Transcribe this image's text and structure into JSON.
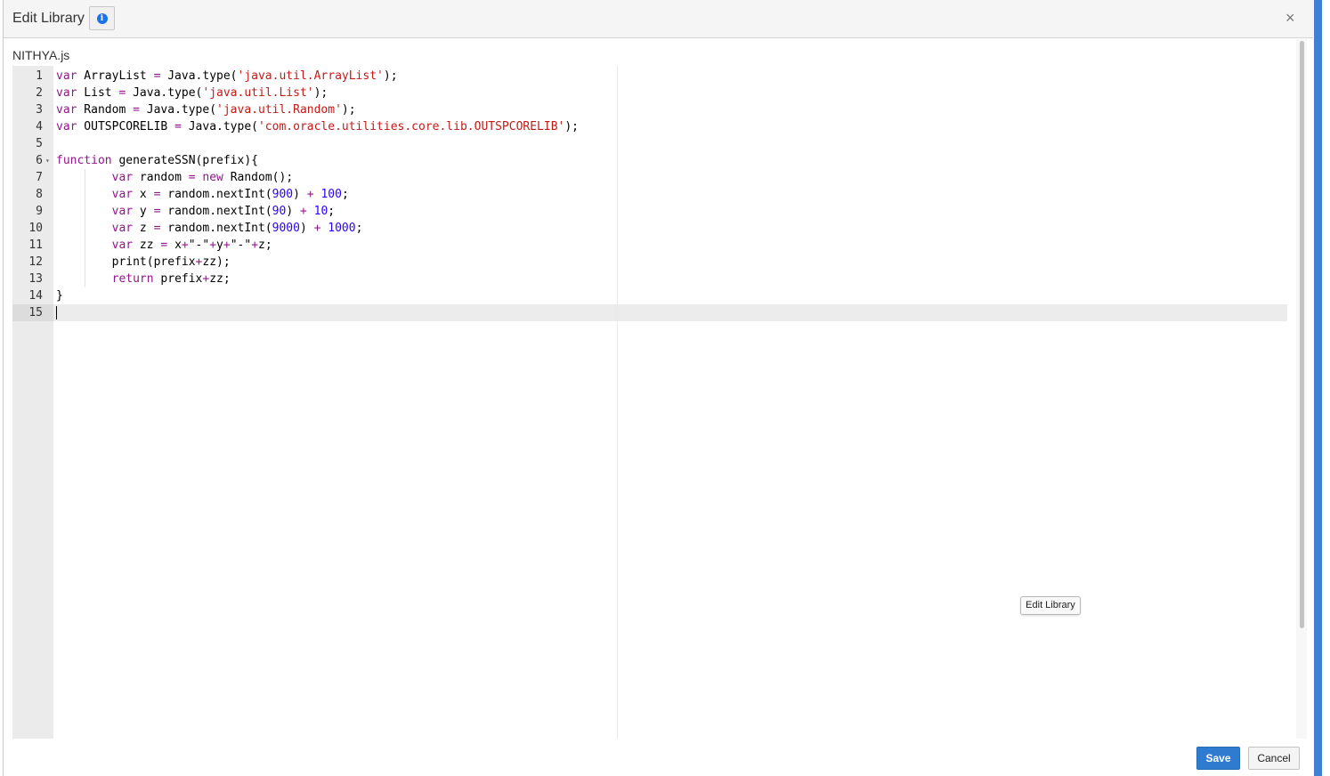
{
  "dialog": {
    "title": "Edit Library",
    "info_icon": "info-icon",
    "close_icon": "close-icon",
    "close_glyph": "×"
  },
  "file": {
    "name": "NITHYA.js"
  },
  "editor": {
    "fold_glyph": "▾",
    "lines": [
      {
        "number": "1",
        "tokens": [
          {
            "t": "var",
            "c": "kw"
          },
          {
            "t": " ArrayList "
          },
          {
            "t": "=",
            "c": "kw"
          },
          {
            "t": " Java.type("
          },
          {
            "t": "'java.util.ArrayList'",
            "c": "str"
          },
          {
            "t": ");"
          }
        ]
      },
      {
        "number": "2",
        "tokens": [
          {
            "t": "var",
            "c": "kw"
          },
          {
            "t": " List "
          },
          {
            "t": "=",
            "c": "kw"
          },
          {
            "t": " Java.type("
          },
          {
            "t": "'java.util.List'",
            "c": "str"
          },
          {
            "t": ");"
          }
        ]
      },
      {
        "number": "3",
        "tokens": [
          {
            "t": "var",
            "c": "kw"
          },
          {
            "t": " Random "
          },
          {
            "t": "=",
            "c": "kw"
          },
          {
            "t": " Java.type("
          },
          {
            "t": "'java.util.Random'",
            "c": "str"
          },
          {
            "t": ");"
          }
        ]
      },
      {
        "number": "4",
        "tokens": [
          {
            "t": "var",
            "c": "kw"
          },
          {
            "t": " OUTSPCORELIB "
          },
          {
            "t": "=",
            "c": "kw"
          },
          {
            "t": " Java.type("
          },
          {
            "t": "'com.oracle.utilities.core.lib.OUTSPCORELIB'",
            "c": "str"
          },
          {
            "t": ");"
          }
        ]
      },
      {
        "number": "5",
        "tokens": []
      },
      {
        "number": "6",
        "fold": true,
        "tokens": [
          {
            "t": "function",
            "c": "kw"
          },
          {
            "t": " generateSSN(prefix){"
          }
        ]
      },
      {
        "number": "7",
        "indent": true,
        "tokens": [
          {
            "t": "        "
          },
          {
            "t": "var",
            "c": "kw"
          },
          {
            "t": " random "
          },
          {
            "t": "=",
            "c": "kw"
          },
          {
            "t": " "
          },
          {
            "t": "new",
            "c": "kw"
          },
          {
            "t": " Random();"
          }
        ]
      },
      {
        "number": "8",
        "indent": true,
        "tokens": [
          {
            "t": "        "
          },
          {
            "t": "var",
            "c": "kw"
          },
          {
            "t": " x "
          },
          {
            "t": "=",
            "c": "kw"
          },
          {
            "t": " random.nextInt("
          },
          {
            "t": "900",
            "c": "num"
          },
          {
            "t": ") "
          },
          {
            "t": "+",
            "c": "kw"
          },
          {
            "t": " "
          },
          {
            "t": "100",
            "c": "num"
          },
          {
            "t": ";"
          }
        ]
      },
      {
        "number": "9",
        "indent": true,
        "tokens": [
          {
            "t": "        "
          },
          {
            "t": "var",
            "c": "kw"
          },
          {
            "t": " y "
          },
          {
            "t": "=",
            "c": "kw"
          },
          {
            "t": " random.nextInt("
          },
          {
            "t": "90",
            "c": "num"
          },
          {
            "t": ") "
          },
          {
            "t": "+",
            "c": "kw"
          },
          {
            "t": " "
          },
          {
            "t": "10",
            "c": "num"
          },
          {
            "t": ";"
          }
        ]
      },
      {
        "number": "10",
        "indent": true,
        "tokens": [
          {
            "t": "        "
          },
          {
            "t": "var",
            "c": "kw"
          },
          {
            "t": " z "
          },
          {
            "t": "=",
            "c": "kw"
          },
          {
            "t": " random.nextInt("
          },
          {
            "t": "9000",
            "c": "num"
          },
          {
            "t": ") "
          },
          {
            "t": "+",
            "c": "kw"
          },
          {
            "t": " "
          },
          {
            "t": "1000",
            "c": "num"
          },
          {
            "t": ";"
          }
        ]
      },
      {
        "number": "11",
        "indent": true,
        "tokens": [
          {
            "t": "        "
          },
          {
            "t": "var",
            "c": "kw"
          },
          {
            "t": " zz "
          },
          {
            "t": "=",
            "c": "kw"
          },
          {
            "t": " x"
          },
          {
            "t": "+",
            "c": "kw"
          },
          {
            "t": "\"-\""
          },
          {
            "t": "+",
            "c": "kw"
          },
          {
            "t": "y"
          },
          {
            "t": "+",
            "c": "kw"
          },
          {
            "t": "\"-\""
          },
          {
            "t": "+",
            "c": "kw"
          },
          {
            "t": "z;"
          }
        ]
      },
      {
        "number": "12",
        "indent": true,
        "tokens": [
          {
            "t": "        print(prefix"
          },
          {
            "t": "+",
            "c": "kw"
          },
          {
            "t": "zz);"
          }
        ]
      },
      {
        "number": "13",
        "indent": true,
        "tokens": [
          {
            "t": "        "
          },
          {
            "t": "return",
            "c": "kw"
          },
          {
            "t": " prefix"
          },
          {
            "t": "+",
            "c": "kw"
          },
          {
            "t": "zz;"
          }
        ]
      },
      {
        "number": "14",
        "tokens": [
          {
            "t": "}"
          }
        ]
      },
      {
        "number": "15",
        "tokens": []
      }
    ]
  },
  "tooltip": {
    "text": "Edit Library"
  },
  "footer": {
    "save_label": "Save",
    "cancel_label": "Cancel"
  },
  "colors": {
    "accent": "#2e7bcf",
    "keyword": "#93168e",
    "string": "#c41a16",
    "number": "#2a00ff"
  }
}
